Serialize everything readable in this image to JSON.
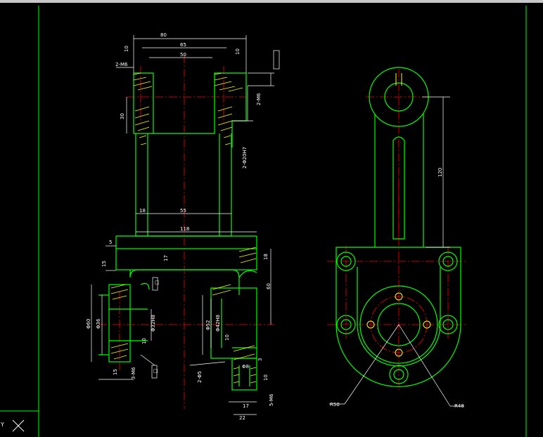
{
  "colors": {
    "background": "#000000",
    "outline": "#00ff00",
    "center_line": "#ff0000",
    "dimension": "#ffffff",
    "hatch": "#ffff00",
    "frame": "#00ff00"
  },
  "front_view": {
    "dims": {
      "top_width_80": "80",
      "width_65": "65",
      "width_50": "50",
      "small_10_left": "10",
      "small_10_right": "10",
      "holes_2m6": "2-M6",
      "height_30": "30",
      "depth_2m6": "2-M6",
      "bore_callout": "2-Φ20H7",
      "wall_18": "18",
      "inner_55": "55",
      "base_118": "118",
      "lip_5": "5",
      "lip_15": "15",
      "step_17": "17",
      "height_60": "60",
      "right_18": "18",
      "dia_60": "Φ60",
      "dia_36": "Φ36",
      "dia_32": "Φ32H8",
      "dia_52": "Φ52",
      "dia_42": "Φ42H8",
      "ten_a": "10",
      "ten_b": "10",
      "ten_c": "15",
      "thread_m6": "3-M6",
      "tol_a": "□",
      "tol_b": "□",
      "hole_m5": "2-Φ5",
      "cb_dia": "Φ8",
      "cb_depth": "3",
      "bot_10": "10",
      "bot_17": "17",
      "bot_22": "22",
      "bot_5m6": "5-M6"
    }
  },
  "side_view": {
    "dims": {
      "length_120": "120",
      "r50": "R50",
      "r48": "R48"
    }
  },
  "ucs_label": "Y"
}
